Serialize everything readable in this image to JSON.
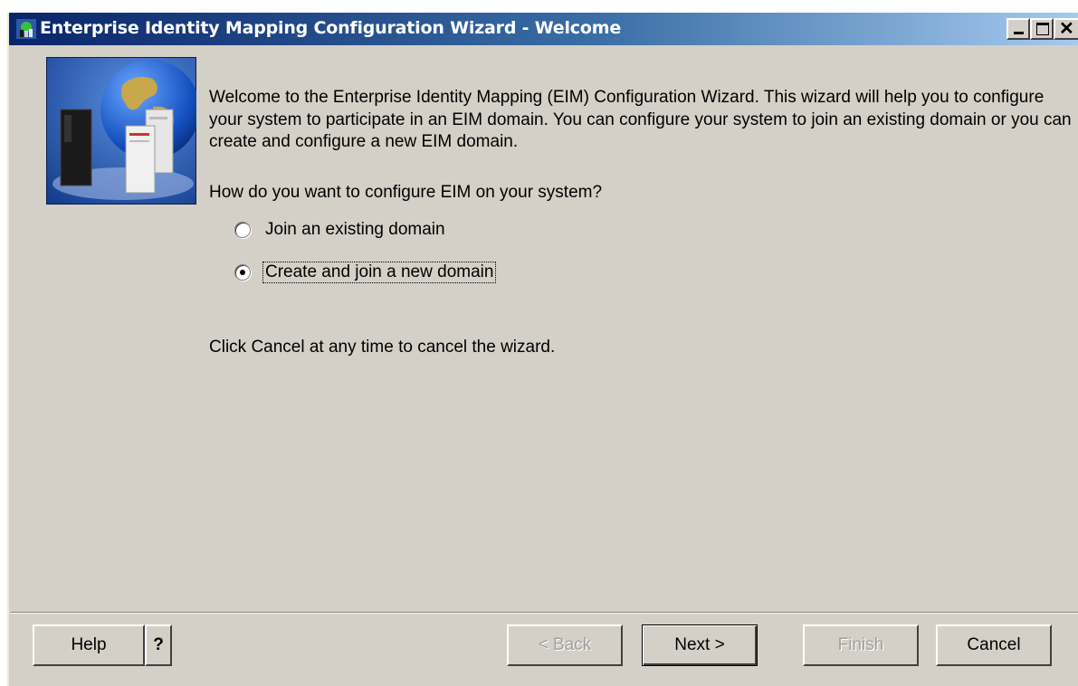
{
  "window": {
    "title": "Enterprise Identity Mapping Configuration Wizard - Welcome",
    "icon": "eim-app-icon",
    "controls": [
      "minimize-icon",
      "maximize-icon",
      "close-icon"
    ]
  },
  "banner": {
    "icon": "eim-servers-globe-image"
  },
  "content": {
    "welcome_text": "Welcome to the Enterprise Identity Mapping (EIM) Configuration Wizard. This wizard will help you to configure your system to participate in an EIM domain.  You can configure your system to join an existing domain or you can create and configure a new EIM domain.",
    "question": "How do you want to configure EIM on your system?",
    "options": [
      {
        "label": "Join an existing domain",
        "selected": false
      },
      {
        "label": "Create and join a new domain",
        "selected": true
      }
    ],
    "cancel_hint": "Click Cancel at any time to cancel the wizard."
  },
  "buttons": {
    "help": {
      "label": "Help",
      "mnemonic": "H"
    },
    "question_mark": "?",
    "back": {
      "label": "< Back",
      "mnemonic": "B",
      "enabled": false
    },
    "next": {
      "label": "Next >",
      "mnemonic": "N",
      "enabled": true,
      "default": true
    },
    "finish": {
      "label": "Finish",
      "mnemonic": "F",
      "enabled": false
    },
    "cancel": {
      "label": "Cancel",
      "mnemonic": "C",
      "enabled": true
    }
  },
  "colors": {
    "titlebar_start": "#0a246a",
    "titlebar_end": "#a6caf0",
    "dialog_bg": "#d4d0c8"
  }
}
